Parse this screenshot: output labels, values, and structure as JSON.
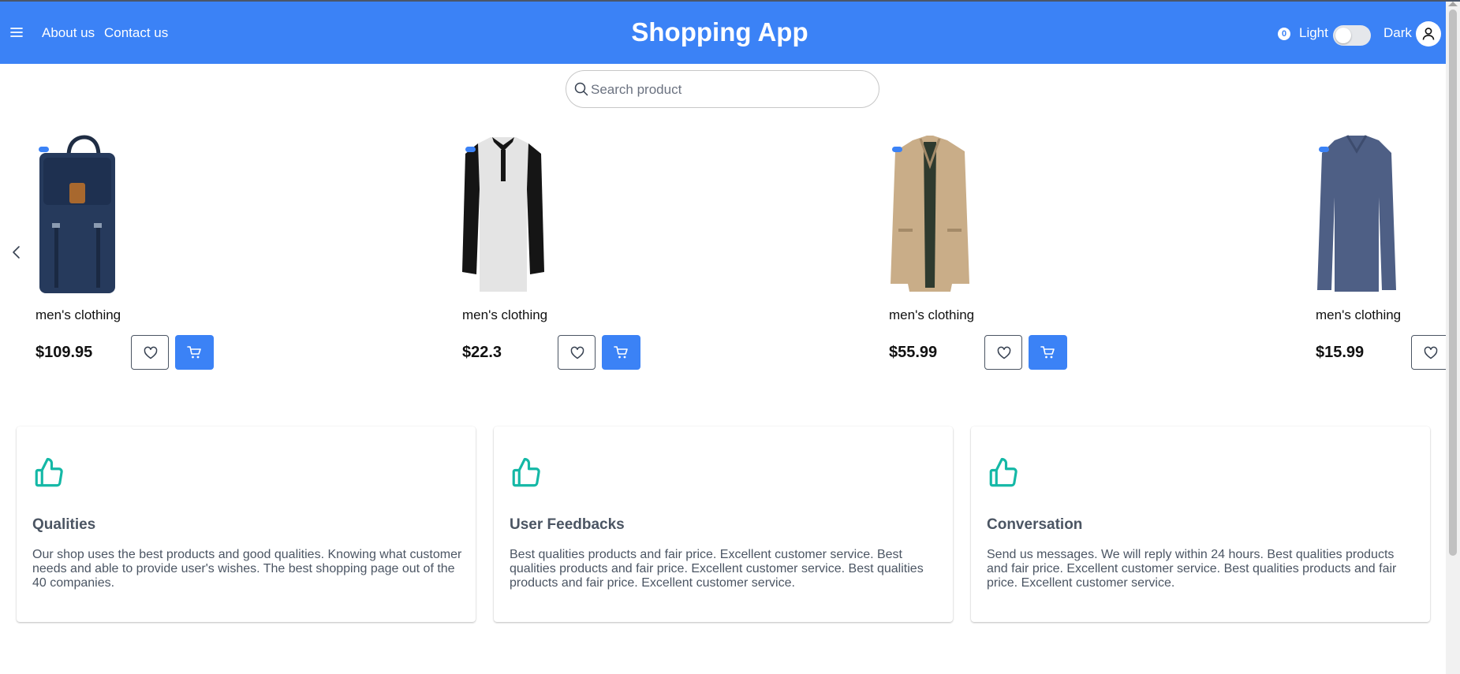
{
  "header": {
    "title": "Shopping App",
    "nav": [
      "About us",
      "Contact us"
    ],
    "cart_count": "0",
    "mode_light": "Light",
    "mode_dark": "Dark",
    "dark_mode_enabled": false
  },
  "search": {
    "placeholder": "Search product",
    "value": ""
  },
  "products": [
    {
      "category": "men's clothing",
      "price": "$109.95",
      "image": "backpack"
    },
    {
      "category": "men's clothing",
      "price": "$22.3",
      "image": "henley-shirt"
    },
    {
      "category": "men's clothing",
      "price": "$55.99",
      "image": "jacket"
    },
    {
      "category": "men's clothing",
      "price": "$15.99",
      "image": "long-sleeve-tee"
    }
  ],
  "features": [
    {
      "title": "Qualities",
      "text": "Our shop uses the best products and good qualities. Knowing what customer needs and able to provide user's wishes. The best shopping page out of the 40 companies."
    },
    {
      "title": "User Feedbacks",
      "text": "Best qualities products and fair price. Excellent customer service. Best qualities products and fair price. Excellent customer service. Best qualities products and fair price. Excellent customer service."
    },
    {
      "title": "Conversation",
      "text": "Send us messages. We will reply within 24 hours. Best qualities products and fair price. Excellent customer service. Best qualities products and fair price. Excellent customer service."
    }
  ],
  "colors": {
    "primary": "#3b82f6",
    "feature_icon": "#14b8a6",
    "text_muted": "#4b5563"
  },
  "icons": {
    "menu": "hamburger-icon",
    "search": "search-icon",
    "avatar": "user-icon",
    "wishlist": "heart-icon",
    "cart": "cart-icon",
    "feature": "thumbs-up-icon",
    "carousel": "chevron-left-icon"
  }
}
